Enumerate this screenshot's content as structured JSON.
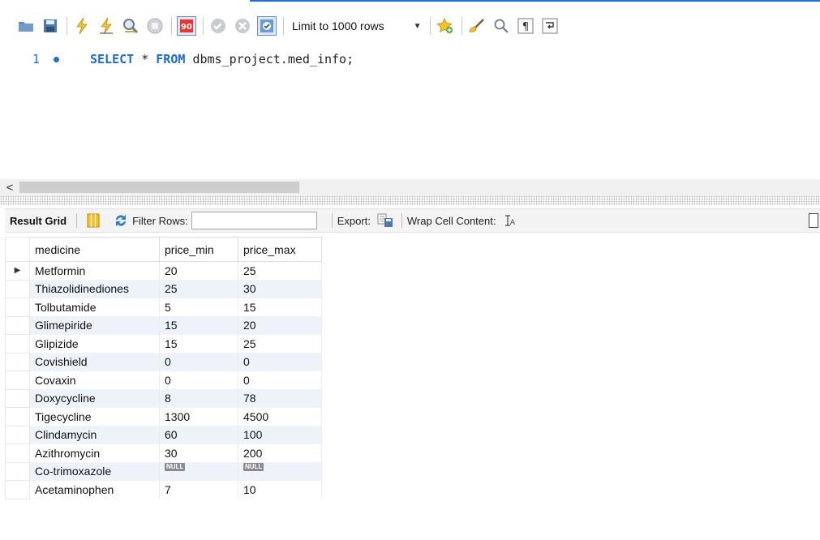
{
  "toolbar": {
    "limit_label": "Limit to 1000 rows",
    "icons": [
      "open-folder-icon",
      "save-icon",
      "execute-icon",
      "execute-current-icon",
      "explain-icon",
      "stop-icon",
      "toggle-error-icon",
      "commit-icon",
      "rollback-icon",
      "autocommit-icon",
      "bookmark-star-icon",
      "beautify-brush-icon",
      "find-icon",
      "invisible-chars-icon",
      "wrap-icon"
    ]
  },
  "editor": {
    "line_number": "1",
    "kw_select": "SELECT",
    "star": "*",
    "kw_from": "FROM",
    "table": "dbms_project.med_info;"
  },
  "result_toolbar": {
    "tab": "Result Grid",
    "filter_label": "Filter Rows:",
    "export_label": "Export:",
    "wrap_label": "Wrap Cell Content:"
  },
  "grid": {
    "columns": [
      "medicine",
      "price_min",
      "price_max"
    ],
    "rows": [
      {
        "medicine": "Metformin",
        "price_min": "20",
        "price_max": "25"
      },
      {
        "medicine": "Thiazolidinediones",
        "price_min": "25",
        "price_max": "30"
      },
      {
        "medicine": "Tolbutamide",
        "price_min": "5",
        "price_max": "15"
      },
      {
        "medicine": "Glimepiride",
        "price_min": "15",
        "price_max": "20"
      },
      {
        "medicine": "Glipizide",
        "price_min": "15",
        "price_max": "25"
      },
      {
        "medicine": "Covishield",
        "price_min": "0",
        "price_max": "0"
      },
      {
        "medicine": "Covaxin",
        "price_min": "0",
        "price_max": "0"
      },
      {
        "medicine": "Doxycycline",
        "price_min": "8",
        "price_max": "78"
      },
      {
        "medicine": "Tigecycline",
        "price_min": "1300",
        "price_max": "4500"
      },
      {
        "medicine": "Clindamycin",
        "price_min": "60",
        "price_max": "100"
      },
      {
        "medicine": "Azithromycin",
        "price_min": "30",
        "price_max": "200"
      },
      {
        "medicine": "Co-trimoxazole",
        "price_min": "NULL",
        "price_max": "NULL"
      },
      {
        "medicine": "Acetaminophen",
        "price_min": "7",
        "price_max": "10"
      }
    ]
  },
  "colors": {
    "accent": "#1e6fd9",
    "keyword": "#1d6ad6",
    "row_alt": "#eef3fa"
  }
}
